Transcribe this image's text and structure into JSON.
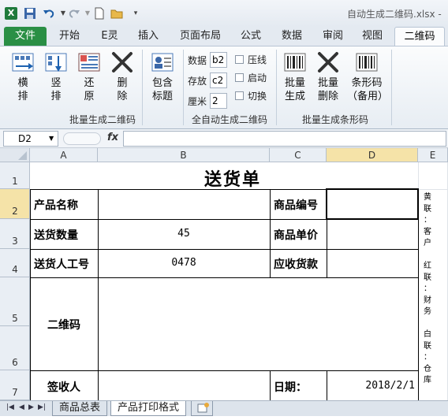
{
  "window": {
    "title": "自动生成二维码.xlsx -",
    "app_icon": "X"
  },
  "ribbon_tabs": [
    {
      "label": "文件"
    },
    {
      "label": "开始"
    },
    {
      "label": "E灵"
    },
    {
      "label": "插入"
    },
    {
      "label": "页面布局"
    },
    {
      "label": "公式"
    },
    {
      "label": "数据"
    },
    {
      "label": "审阅"
    },
    {
      "label": "视图"
    },
    {
      "label": "二维码"
    }
  ],
  "ribbon": {
    "group1": {
      "buttons": [
        {
          "label": "横\n排",
          "icon": "horizontal-arrange-icon"
        },
        {
          "label": "竖\n排",
          "icon": "vertical-arrange-icon"
        },
        {
          "label": "还\n原",
          "icon": "restore-icon"
        },
        {
          "label": "删\n除",
          "icon": "delete-x-icon"
        },
        {
          "label": "包含\n标题",
          "icon": "contact-card-icon"
        }
      ],
      "label": "批量生成二维码"
    },
    "group2": {
      "fields": [
        {
          "label": "数据",
          "value": "b2"
        },
        {
          "label": "存放",
          "value": "c2"
        },
        {
          "label": "厘米",
          "value": "2"
        }
      ],
      "checkboxes": [
        {
          "label": "压线"
        },
        {
          "label": "启动"
        },
        {
          "label": "切换"
        }
      ],
      "label": "全自动生成二维码"
    },
    "group3": {
      "buttons": [
        {
          "label": "批量\n生成",
          "icon": "barcode-icon"
        },
        {
          "label": "批量\n删除",
          "icon": "delete-x-icon"
        },
        {
          "label": "条形码\n（备用）",
          "icon": "barcode-icon"
        }
      ],
      "label": "批量生成条形码"
    }
  },
  "formula_bar": {
    "name_box": "D2",
    "fx": "fx",
    "value": ""
  },
  "sheet": {
    "columns": [
      "A",
      "B",
      "C",
      "D",
      "E"
    ],
    "rows": [
      "1",
      "2",
      "3",
      "4",
      "5",
      "6",
      "7"
    ],
    "title": "送货单",
    "cells": {
      "A2": "产品名称",
      "A3": "送货数量",
      "A4": "送货人工号",
      "A5": "二维码",
      "A7": "签收人",
      "B3": "45",
      "B4": "0478",
      "C2": "商品编号",
      "C3": "商品单价",
      "C4": "应收货款",
      "C7": "日期：",
      "D7": "2018/2/1"
    },
    "side_note": [
      "黄",
      "联",
      "：",
      "客",
      "户",
      "",
      "红",
      "联",
      "：",
      "财",
      "务",
      "",
      "白",
      "联",
      "：",
      "仓",
      "库"
    ]
  },
  "sheet_tabs": [
    {
      "label": "商品总表",
      "active": false
    },
    {
      "label": "产品打印格式",
      "active": true
    }
  ]
}
